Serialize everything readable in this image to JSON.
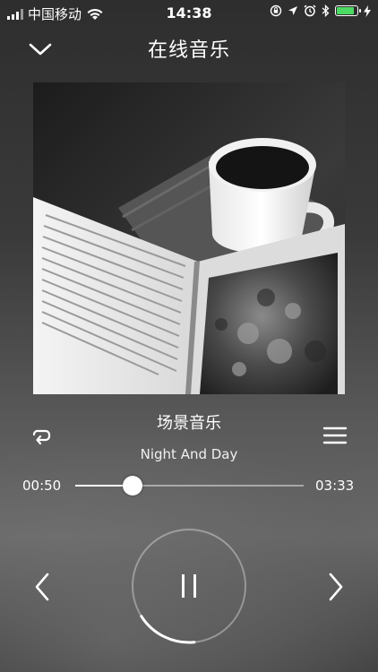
{
  "status_bar": {
    "carrier": "中国移动",
    "time": "14:38",
    "icons": [
      "signal-icon",
      "wifi-icon",
      "rotation-lock-icon",
      "location-icon",
      "alarm-icon",
      "bluetooth-icon",
      "battery-icon",
      "charging-icon"
    ],
    "battery_color": "#4cd964"
  },
  "header": {
    "title": "在线音乐",
    "collapse_icon": "chevron-down-icon"
  },
  "album": {
    "art_icon": "album-art-book-coffee"
  },
  "track": {
    "title": "场景音乐",
    "song": "Night And Day"
  },
  "progress": {
    "elapsed": "00:50",
    "total": "03:33",
    "fraction": 0.252
  },
  "controls": {
    "repeat_icon": "repeat-icon",
    "playlist_icon": "playlist-icon",
    "prev_icon": "chevron-left-icon",
    "next_icon": "chevron-right-icon",
    "play_state_icon": "pause-icon",
    "ring_progress": 0.25
  },
  "colors": {
    "accent": "#ffffff",
    "background": "#3a3a3a"
  }
}
